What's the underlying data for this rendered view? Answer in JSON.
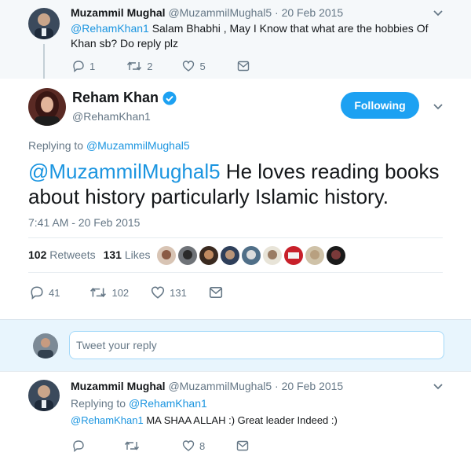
{
  "top_tweet": {
    "name": "Muzammil Mughal",
    "handle_date": "@MuzammilMughal5 · 20 Feb 2015",
    "mention": "@RehamKhan1",
    "text": " Salam Bhabhi , May I Know that what are the hobbies Of Khan sb? Do reply plz",
    "replies": "1",
    "retweets": "2",
    "likes": "5"
  },
  "main_tweet": {
    "name": "Reham Khan",
    "handle": "@RehamKhan1",
    "follow_label": "Following",
    "replying_prefix": "Replying to ",
    "replying_to": "@MuzammilMughal5",
    "mention": "@MuzammilMughal5",
    "text": " He loves reading books about history particularly Islamic history.",
    "timestamp": "7:41 AM - 20 Feb 2015",
    "retweet_count": "102",
    "retweet_label": "Retweets",
    "like_count": "131",
    "like_label": "Likes",
    "replies": "41",
    "retweets": "102",
    "likes": "131"
  },
  "reply_box": {
    "placeholder": "Tweet your reply"
  },
  "bottom_tweet": {
    "name": "Muzammil Mughal",
    "handle_date": "@MuzammilMughal5 · 20 Feb 2015",
    "replying_prefix": "Replying to ",
    "replying_to": "@RehamKhan1",
    "mention": "@RehamKhan1",
    "text": " MA SHAA ALLAH :) Great leader Indeed :)",
    "likes": "8"
  },
  "colors": {
    "accent": "#1da1f2",
    "link": "#1b95e0",
    "muted": "#657786"
  }
}
